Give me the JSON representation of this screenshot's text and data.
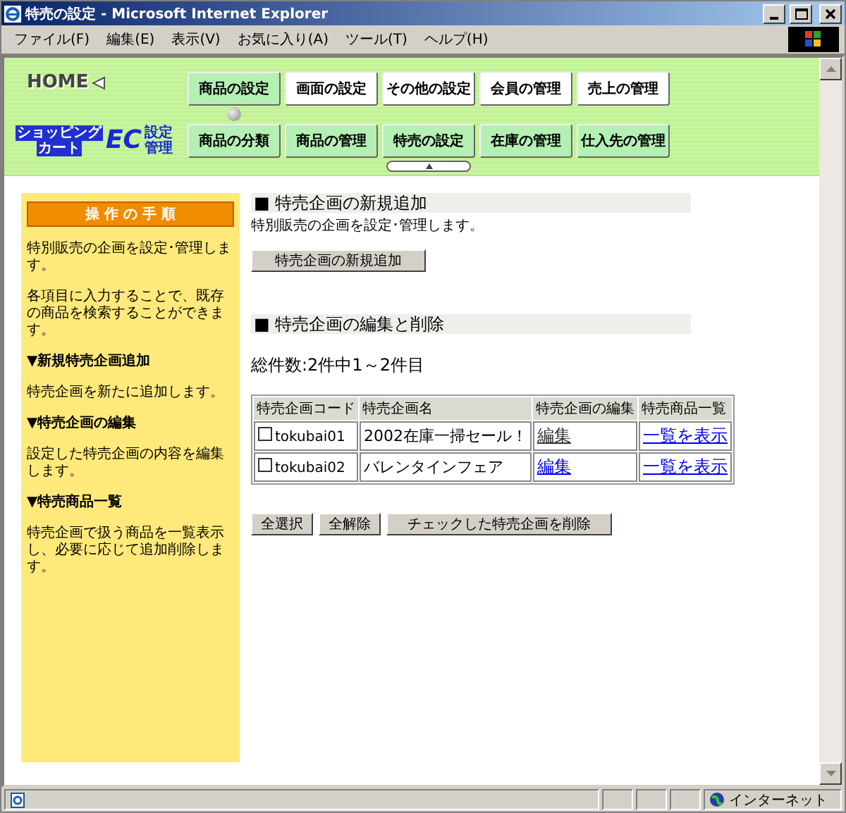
{
  "window": {
    "title": "特売の設定 - Microsoft Internet Explorer"
  },
  "menu": [
    "ファイル(F)",
    "編集(E)",
    "表示(V)",
    "お気に入り(A)",
    "ツール(T)",
    "ヘルプ(H)"
  ],
  "header": {
    "home": "HOME",
    "logo_line1": "ショッピング",
    "logo_line2": "カート",
    "logo_ec": "EC",
    "logo_sub1": "設定",
    "logo_sub2": "管理",
    "main_nav": [
      {
        "label": "商品の設定",
        "selected": true
      },
      {
        "label": "画面の設定",
        "selected": false
      },
      {
        "label": "その他の設定",
        "selected": false
      },
      {
        "label": "会員の管理",
        "selected": false
      },
      {
        "label": "売上の管理",
        "selected": false
      }
    ],
    "sub_nav": [
      {
        "label": "商品の分類",
        "selected": false
      },
      {
        "label": "商品の管理",
        "selected": false
      },
      {
        "label": "特売の設定",
        "selected": true
      },
      {
        "label": "在庫の管理",
        "selected": false
      },
      {
        "label": "仕入先の管理",
        "selected": false
      }
    ]
  },
  "sidebar": {
    "title": "操 作 の 手 順",
    "items": [
      {
        "kind": "text",
        "text": "特別販売の企画を設定･管理します。"
      },
      {
        "kind": "text",
        "text": "各項目に入力することで、既存の商品を検索することができます。"
      },
      {
        "kind": "heading",
        "text": "▼新規特売企画追加"
      },
      {
        "kind": "text",
        "text": "特売企画を新たに追加します。"
      },
      {
        "kind": "heading",
        "text": "▼特売企画の編集"
      },
      {
        "kind": "text",
        "text": "設定した特売企画の内容を編集します。"
      },
      {
        "kind": "heading",
        "text": "▼特売商品一覧"
      },
      {
        "kind": "text",
        "text": "特売企画で扱う商品を一覧表示し、必要に応じて追加削除します。"
      }
    ]
  },
  "add_section": {
    "heading": "■ 特売企画の新規追加",
    "description": "特別販売の企画を設定･管理します。",
    "button": "特売企画の新規追加"
  },
  "edit_section": {
    "heading": "■ 特売企画の編集と削除",
    "count": "総件数:2件中1～2件目",
    "table": {
      "columns": [
        "特売企画コード",
        "特売企画名",
        "特売企画の編集",
        "特売商品一覧"
      ],
      "rows": [
        {
          "checked": false,
          "code": "tokubai01",
          "name": "2002在庫一掃セール！",
          "edit": "編集",
          "edit_visited": true,
          "list": "一覧を表示"
        },
        {
          "checked": false,
          "code": "tokubai02",
          "name": "バレンタインフェア",
          "edit": "編集",
          "edit_visited": false,
          "list": "一覧を表示"
        }
      ]
    },
    "buttons": [
      "全選択",
      "全解除",
      "チェックした特売企画を削除"
    ]
  },
  "status_bar": {
    "zone": "インターネット"
  }
}
